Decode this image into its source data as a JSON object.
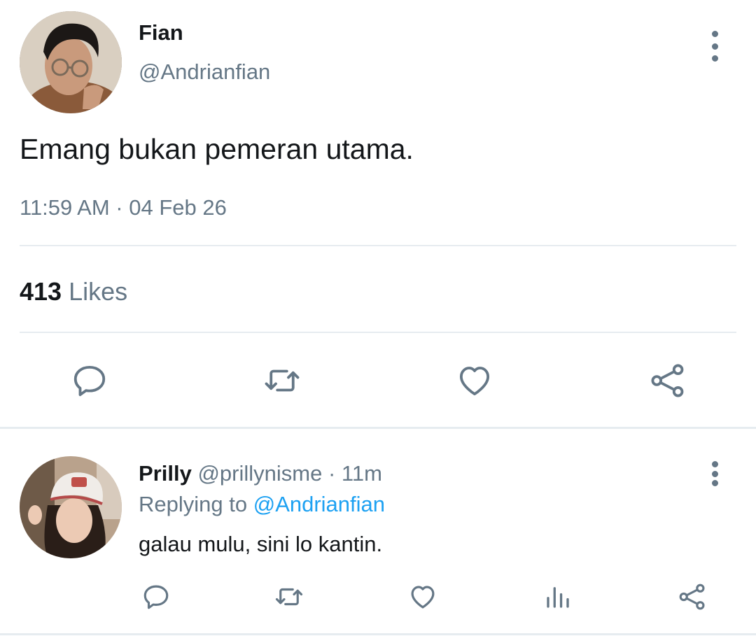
{
  "main_tweet": {
    "author_name": "Fian",
    "author_handle": "@Andrianfian",
    "text": "Emang bukan pemeran utama.",
    "timestamp": "11:59 AM · 04 Feb 26",
    "likes_count": "413",
    "likes_label": "Likes",
    "avatar_icon": "avatar-man-glasses"
  },
  "reply": {
    "author_name": "Prilly",
    "author_handle": "@prillynisme",
    "separator": "·",
    "time_ago": "11m",
    "replying_to_label": "Replying to",
    "replying_to_handle": "@Andrianfian",
    "text": "galau mulu, sini lo kantin.",
    "avatar_icon": "avatar-woman-cap"
  },
  "colors": {
    "text": "#14171a",
    "muted": "#657786",
    "link": "#1da1f2",
    "divider": "#e6ecf0"
  },
  "icons": {
    "action_bar": [
      "reply-icon",
      "retweet-icon",
      "like-icon",
      "share-icon"
    ],
    "reply_action_bar": [
      "reply-icon",
      "retweet-icon",
      "like-icon",
      "analytics-icon",
      "share-icon"
    ],
    "menu": "more-vertical-icon"
  }
}
